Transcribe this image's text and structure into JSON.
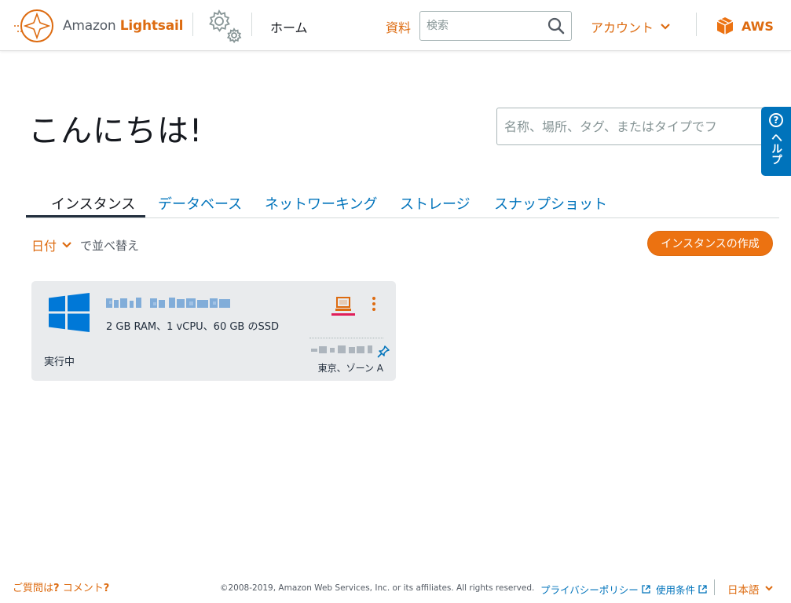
{
  "header": {
    "brand_prefix": "Amazon ",
    "brand_name": "Lightsail",
    "home_label": "ホーム",
    "docs_label": "資料",
    "search_placeholder": "検索",
    "account_label": "アカウント",
    "aws_label": "AWS"
  },
  "greeting": "こんにちは!",
  "filter": {
    "placeholder": "名称、場所、タグ、またはタイプでフ"
  },
  "help": {
    "label": "ヘルプ"
  },
  "tabs": [
    {
      "label": "インスタンス",
      "active": true
    },
    {
      "label": "データベース",
      "active": false
    },
    {
      "label": "ネットワーキング",
      "active": false
    },
    {
      "label": "ストレージ",
      "active": false
    },
    {
      "label": "スナップショット",
      "active": false
    }
  ],
  "sort": {
    "key": "日付",
    "suffix": "で並べ替え"
  },
  "create_button": "インスタンスの作成",
  "instance": {
    "specs": "2 GB RAM、1 vCPU、60 GB のSSD",
    "status": "実行中",
    "region": "東京、ゾーン A"
  },
  "footer": {
    "feedback_prefix": "ご質問は",
    "feedback_q1": "?",
    "feedback_mid": " コメント",
    "feedback_q2": "?",
    "copyright": "©2008-2019, Amazon Web Services, Inc. or its affiliates. All rights reserved.",
    "privacy_label": "プライバシーポリシー",
    "terms_label": "使用条件",
    "language_label": "日本語"
  },
  "colors": {
    "accent": "#dd6b10",
    "link": "#0073bb",
    "button": "#ec7211",
    "card_bg": "#e9ebed",
    "connect_bar": "#e01e5a"
  }
}
